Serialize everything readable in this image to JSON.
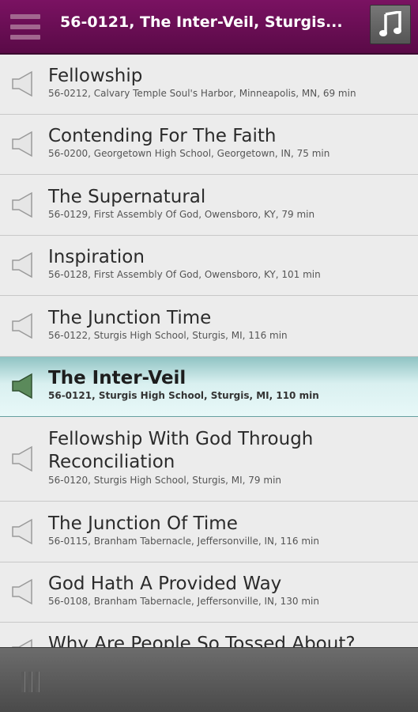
{
  "header": {
    "title": "56-0121, The Inter-Veil, Sturgis...",
    "menu_icon": "hamburger-menu-icon",
    "music_icon": "music-note-icon"
  },
  "colors": {
    "header_bg": "#6a0e55",
    "active_row": "#cfeeee",
    "speaker_active": "#5b8a5b",
    "speaker_inactive": "#e4e4e4"
  },
  "sermons": [
    {
      "title": "Fellowship",
      "subtitle": "56-0212, Calvary Temple Soul's Harbor, Minneapolis, MN, 69 min",
      "active": false
    },
    {
      "title": "Contending For The Faith",
      "subtitle": "56-0200, Georgetown High School, Georgetown, IN, 75 min",
      "active": false
    },
    {
      "title": "The Supernatural",
      "subtitle": "56-0129, First Assembly Of God, Owensboro, KY, 79 min",
      "active": false
    },
    {
      "title": "Inspiration",
      "subtitle": "56-0128, First Assembly Of God, Owensboro, KY, 101 min",
      "active": false
    },
    {
      "title": "The Junction Time",
      "subtitle": "56-0122, Sturgis High School, Sturgis, MI, 116 min",
      "active": false
    },
    {
      "title": "The Inter-Veil",
      "subtitle": "56-0121, Sturgis High School, Sturgis, MI, 110 min",
      "active": true
    },
    {
      "title": "Fellowship With God Through Reconciliation",
      "subtitle": "56-0120, Sturgis High School, Sturgis, MI, 79 min",
      "active": false
    },
    {
      "title": "The Junction Of Time",
      "subtitle": "56-0115, Branham Tabernacle, Jeffersonville, IN, 116 min",
      "active": false
    },
    {
      "title": "God Hath A Provided Way",
      "subtitle": "56-0108, Branham Tabernacle, Jeffersonville, IN, 130 min",
      "active": false
    },
    {
      "title": "Why Are People So Tossed About?",
      "subtitle": "",
      "active": false
    }
  ]
}
